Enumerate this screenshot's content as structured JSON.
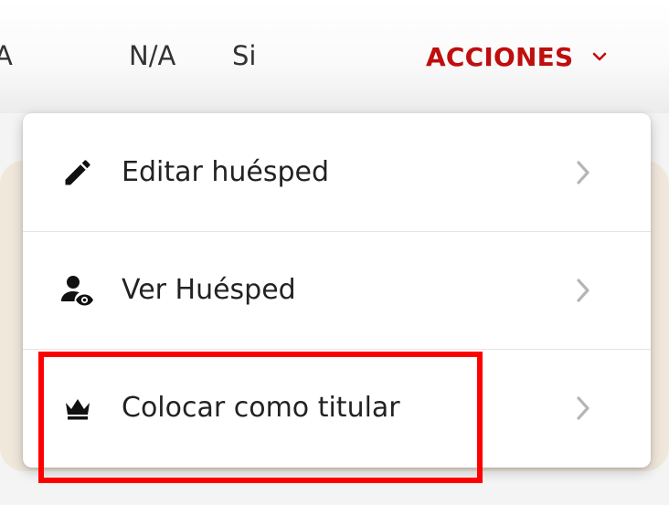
{
  "table_row": {
    "cells": [
      "A",
      "N/A",
      "Si"
    ],
    "actions_label": "ACCIONES"
  },
  "dropdown": {
    "items": [
      {
        "label": "Editar huésped",
        "icon": "pencil-icon"
      },
      {
        "label": "Ver Huésped",
        "icon": "person-eye-icon"
      },
      {
        "label": "Colocar como titular",
        "icon": "crown-icon"
      }
    ]
  },
  "colors": {
    "accent": "#c00d0d",
    "highlight": "#ff0000",
    "card_bg": "#f1e8dc"
  }
}
